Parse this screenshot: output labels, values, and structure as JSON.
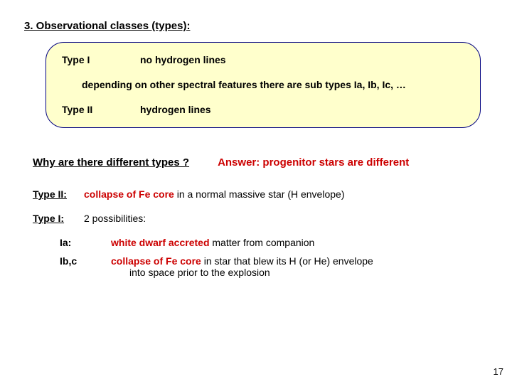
{
  "heading": "3. Observational classes (types):",
  "box": {
    "type1_label": "Type I",
    "type1_desc": "no hydrogen lines",
    "subtypes_line": "depending on other spectral features there are sub types Ia, Ib, Ic, …",
    "type2_label": "Type II",
    "type2_desc": "hydrogen lines"
  },
  "why": {
    "question": "Why are there different types ?",
    "answer": "Answer: progenitor stars are different"
  },
  "details": {
    "type2": {
      "label": "Type II:",
      "red": "collapse of Fe core",
      "rest": " in a normal massive star (H envelope)"
    },
    "type1": {
      "label": "Type I:",
      "text": "2 possibilities:"
    },
    "ia": {
      "label": "Ia:",
      "red": "white dwarf accreted",
      "rest": " matter from companion"
    },
    "ibc": {
      "label": "Ib,c",
      "red": "collapse of Fe core",
      "rest": " in star that blew its H (or He) envelope",
      "cont": "into space prior to the explosion"
    }
  },
  "page_number": "17"
}
